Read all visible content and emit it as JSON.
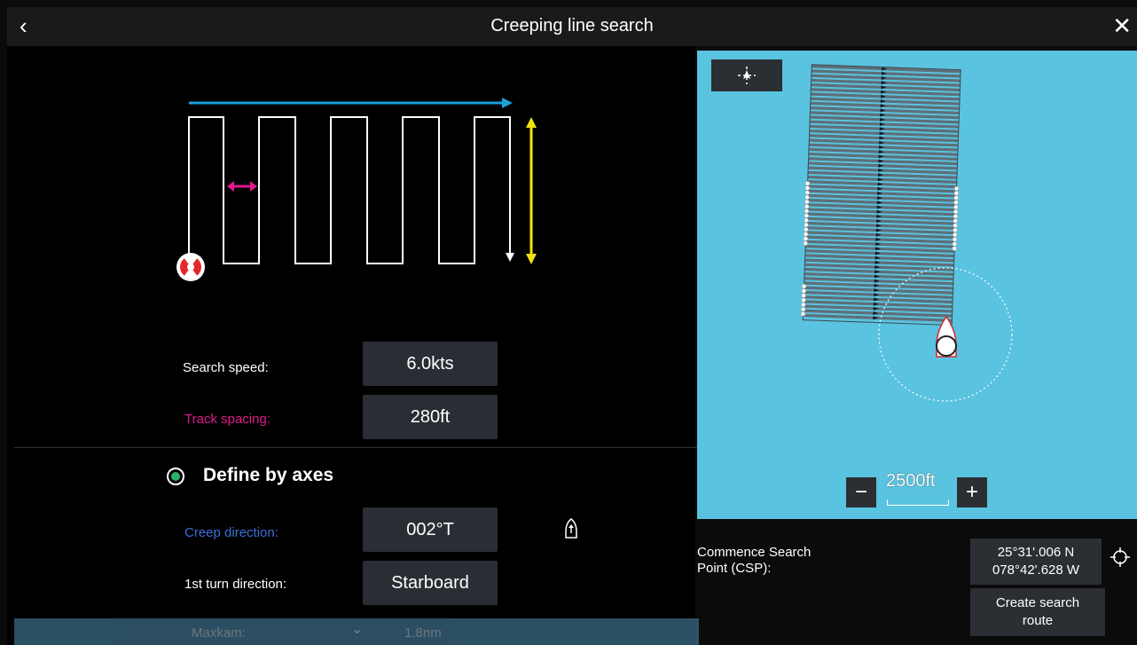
{
  "header": {
    "title": "Creeping line search",
    "back_icon": "chevron-left-icon",
    "close_icon": "close-icon"
  },
  "form": {
    "search_speed": {
      "label": "Search speed:",
      "value": "6.0kts"
    },
    "track_spacing": {
      "label": "Track spacing:",
      "value": "280ft",
      "color": "#e0198a"
    },
    "define_by_axes": {
      "label": "Define by axes",
      "selected": true
    },
    "creep_direction": {
      "label": "Creep direction:",
      "value": "002°T",
      "color": "#3e6fd8"
    },
    "first_turn": {
      "label": "1st turn direction:",
      "value": "Starboard"
    },
    "partial_row": {
      "label": "Maxkam:",
      "value": "1.8nm"
    }
  },
  "map": {
    "scale_label": "2500ft",
    "zoom_out": "−",
    "zoom_in": "+",
    "center_icon": "vessel-center-icon"
  },
  "csp": {
    "label_line1": "Commence Search",
    "label_line2": "Point (CSP):",
    "lat": "25°31'.006 N",
    "lon": "078°42'.628 W",
    "create_line1": "Create search",
    "create_line2": "route"
  },
  "colors": {
    "accent_blue": "#1aa0d8",
    "yellow": "#f4e210",
    "magenta": "#e0198a",
    "map_water": "#5ac3df",
    "radio_green": "#2fb06a"
  }
}
